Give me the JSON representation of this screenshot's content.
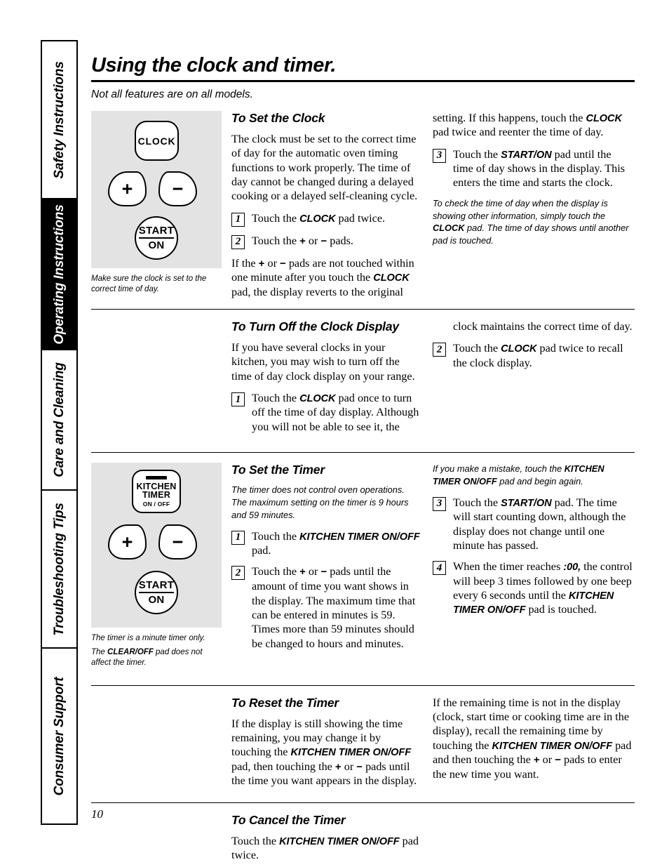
{
  "sidebar": {
    "tabs": [
      {
        "label": "Safety Instructions",
        "active": false
      },
      {
        "label": "Operating Instructions",
        "active": true
      },
      {
        "label": "Care and Cleaning",
        "active": false
      },
      {
        "label": "Troubleshooting Tips",
        "active": false
      },
      {
        "label": "Consumer Support",
        "active": false
      }
    ]
  },
  "page": {
    "title": "Using the clock and timer.",
    "subtitle": "Not all features are on all models.",
    "number": "10"
  },
  "illustrations": {
    "clock": {
      "keys": {
        "clock": "CLOCK",
        "plus": "+",
        "minus": "−",
        "start_line1": "START",
        "start_line2": "ON"
      },
      "caption_line1": "Make sure the clock is set to the",
      "caption_line2": "correct time of day."
    },
    "timer": {
      "keys": {
        "kitchen_line1": "KITCHEN",
        "kitchen_line2": "TIMER",
        "kitchen_line3": "ON / OFF",
        "plus": "+",
        "minus": "−",
        "start_line1": "START",
        "start_line2": "ON"
      },
      "caption_1": "The timer is a minute timer only.",
      "caption_2_pre": "The ",
      "caption_2_bold": "CLEAR/OFF",
      "caption_2_post": " pad does not affect the timer."
    }
  },
  "sections": {
    "set_clock": {
      "heading": "To Set the Clock",
      "intro": "The clock must be set to the correct time of day for the automatic oven timing functions to work properly. The time of day cannot be changed during a delayed cooking or a delayed self-cleaning cycle.",
      "step1_num": "1",
      "step1_pre": "Touch the ",
      "step1_bold": "CLOCK",
      "step1_post": " pad twice.",
      "step2_num": "2",
      "step2_pre": "Touch the ",
      "step2_sym1": "+",
      "step2_mid": " or ",
      "step2_sym2": "−",
      "step2_post": " pads.",
      "after_pre": "If the ",
      "after_sym1": "+",
      "after_mid": " or ",
      "after_sym2": "−",
      "after_post1": " pads are not touched within one minute after you touch the ",
      "after_bold": "CLOCK",
      "after_post2": " pad, the display reverts to the original",
      "cont_pre": "setting. If this happens, touch the ",
      "cont_bold": "CLOCK",
      "cont_post": " pad twice and reenter the time of day.",
      "step3_num": "3",
      "step3_pre": "Touch the ",
      "step3_bold": "START/ON",
      "step3_post": " pad until the time of day shows in the display. This enters the time and starts the clock.",
      "note_pre": "To check the time of day when the display is showing other information, simply touch the ",
      "note_bold": "CLOCK",
      "note_post": " pad. The time of day shows until another pad is touched."
    },
    "turn_off_clock": {
      "heading": "To Turn Off the Clock Display",
      "intro": "If you have several clocks in your kitchen, you may wish to turn off the time of day clock display on your range.",
      "step1_num": "1",
      "step1_pre": "Touch the ",
      "step1_bold": "CLOCK",
      "step1_post": " pad once to turn off the time of day display. Although you will not be able to see it, the",
      "cont": "clock maintains the correct time of day.",
      "step2_num": "2",
      "step2_pre": "Touch the ",
      "step2_bold": "CLOCK",
      "step2_post": " pad twice to recall the clock display."
    },
    "set_timer": {
      "heading": "To Set the Timer",
      "note_intro": "The timer does not control oven operations. The maximum setting on the timer is 9 hours and 59 minutes.",
      "step1_num": "1",
      "step1_pre": "Touch the ",
      "step1_bold": "KITCHEN TIMER ON/OFF",
      "step1_post": " pad.",
      "step2_num": "2",
      "step2_pre": "Touch the ",
      "step2_sym1": "+",
      "step2_mid": " or ",
      "step2_sym2": "−",
      "step2_post": " pads until the amount of time you want shows in the display. The maximum time that can be entered in minutes is 59. Times more than 59 minutes should be changed to hours and minutes.",
      "mistake_pre": "If you make a mistake, touch the ",
      "mistake_bold": "KITCHEN TIMER ON/OFF",
      "mistake_post": " pad and begin again.",
      "step3_num": "3",
      "step3_pre": "Touch the ",
      "step3_bold": "START/ON",
      "step3_post": " pad. The time will start counting down, although the display does not change until one minute has passed.",
      "step4_num": "4",
      "step4_pre": "When the timer reaches ",
      "step4_bold1": ":00,",
      "step4_mid": " the control will beep 3 times followed by one beep every 6 seconds until the ",
      "step4_bold2": "KITCHEN TIMER ON/OFF",
      "step4_post": " pad is touched."
    },
    "reset_timer": {
      "heading": "To Reset the Timer",
      "left_pre": "If the display is still showing the time remaining, you may change it by touching the ",
      "left_bold": "KITCHEN TIMER ON/OFF",
      "left_mid": " pad, then touching the ",
      "left_sym1": "+",
      "left_or": " or ",
      "left_sym2": "−",
      "left_post": " pads until the time you want appears in the display.",
      "right_pre": "If the remaining time is not in the display (clock, start time or cooking time are in the display), recall the remaining time by touching the ",
      "right_bold": "KITCHEN TIMER ON/OFF",
      "right_mid": " pad and then touching the ",
      "right_sym1": "+",
      "right_or": " or ",
      "right_sym2": "−",
      "right_post": " pads to enter the new time you want."
    },
    "cancel_timer": {
      "heading": "To Cancel the Timer",
      "text_pre": "Touch the ",
      "text_bold": "KITCHEN TIMER ON/OFF",
      "text_post": " pad twice."
    }
  }
}
